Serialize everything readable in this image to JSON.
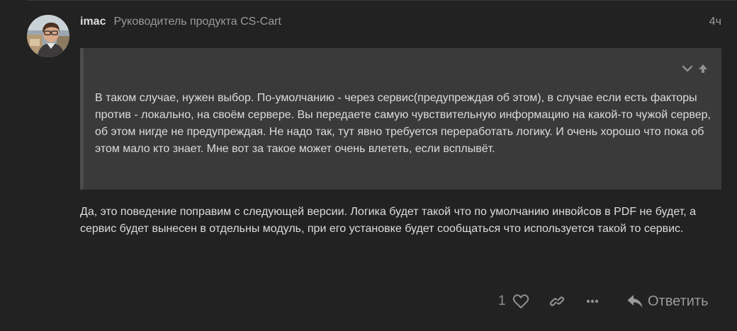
{
  "post": {
    "username": "imac",
    "user_title": "Руководитель продукта CS-Cart",
    "date": "4ч",
    "avatar": "avatar",
    "quote": {
      "text": "В таком случае, нужен выбор. По-умолчанию - через сервис(предупреждая об этом), в случае если есть факторы против - локально, на своём сервере. Вы передаете самую чувствительную информацию на какой-то чужой сервер, об этом нигде не предупреждая. Не надо так, тут явно требуется переработать логику. И очень хорошо что пока об этом мало кто знает. Мне вот за такое может очень влететь, если всплывёт.",
      "controls": [
        "chevron-down-icon",
        "arrow-up-icon"
      ]
    },
    "body": "Да, это поведение поправим с следующей версии. Логика будет такой что по умолчанию инвойсов в PDF не будет, а сервис будет вынесен в отдельны модуль, при его установке будет сообщаться что используется такой то сервис."
  },
  "actions": {
    "like_count": "1",
    "like_icon": "heart-icon",
    "link_icon": "link-icon",
    "more_icon": "ellipsis-icon",
    "reply_icon": "reply-icon",
    "reply_label": "Ответить"
  },
  "colors": {
    "background": "#222222",
    "quote_background": "#3a3a3a",
    "quote_border": "#4c4c4c",
    "text": "#dddddd",
    "muted": "#9a9a9a"
  }
}
